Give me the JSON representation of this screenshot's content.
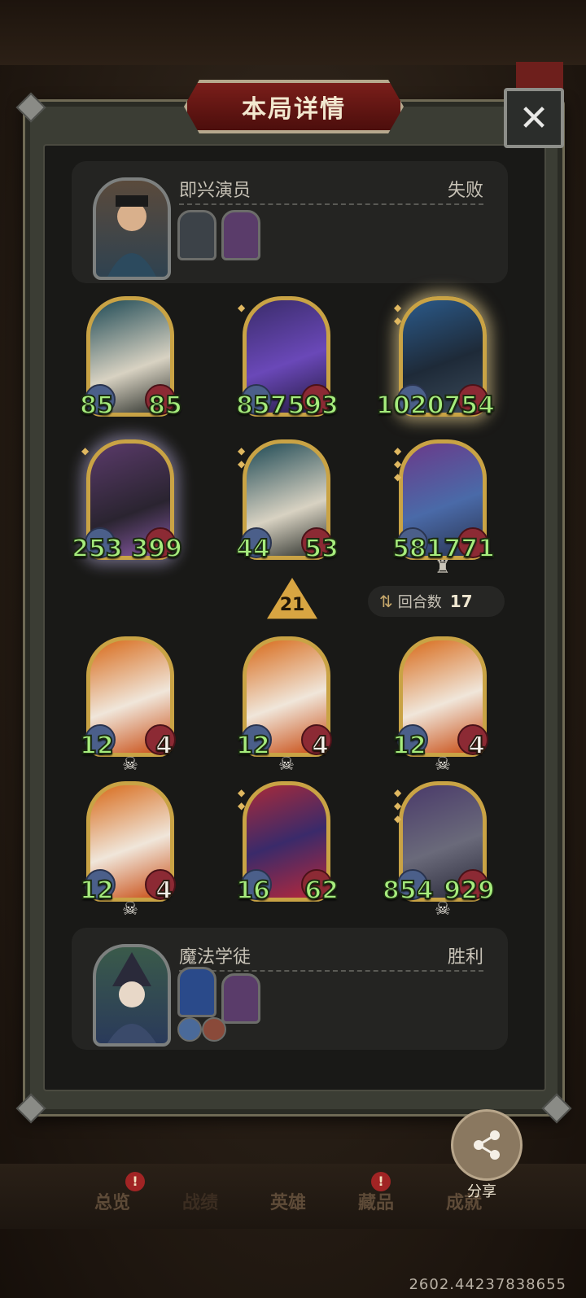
{
  "dialog": {
    "title": "本局详情",
    "close_symbol": "✕"
  },
  "opponent": {
    "name": "即兴演员",
    "result": "失败"
  },
  "player": {
    "name": "魔法学徒",
    "result": "胜利"
  },
  "opponent_board": [
    {
      "atk": "85",
      "hp": "85"
    },
    {
      "atk": "857",
      "hp": "593"
    },
    {
      "atk": "1020",
      "hp": "754"
    },
    {
      "atk": "253",
      "hp": "399"
    },
    {
      "atk": "44",
      "hp": "53"
    },
    {
      "atk": "581",
      "hp": "771"
    }
  ],
  "player_board": [
    {
      "atk": "12",
      "hp": "4"
    },
    {
      "atk": "12",
      "hp": "4"
    },
    {
      "atk": "12",
      "hp": "4"
    },
    {
      "atk": "12",
      "hp": "4"
    },
    {
      "atk": "16",
      "hp": "62"
    },
    {
      "atk": "854",
      "hp": "929"
    }
  ],
  "tier": "21",
  "rounds": {
    "label": "回合数",
    "value": "17"
  },
  "share_label": "分享",
  "tabs": [
    "总览",
    "战绩",
    "英雄",
    "藏品",
    "成就"
  ],
  "badge": "!",
  "serial": "2602.44237838655",
  "icons": {
    "skull": "skull-icon",
    "share": "share-icon",
    "rounds": "swap-arrows-icon",
    "close": "close-icon"
  },
  "colors": {
    "stat_green": "#a6ec7d",
    "frame_gold": "#c9a345",
    "title_red": "#7a1e1a"
  }
}
